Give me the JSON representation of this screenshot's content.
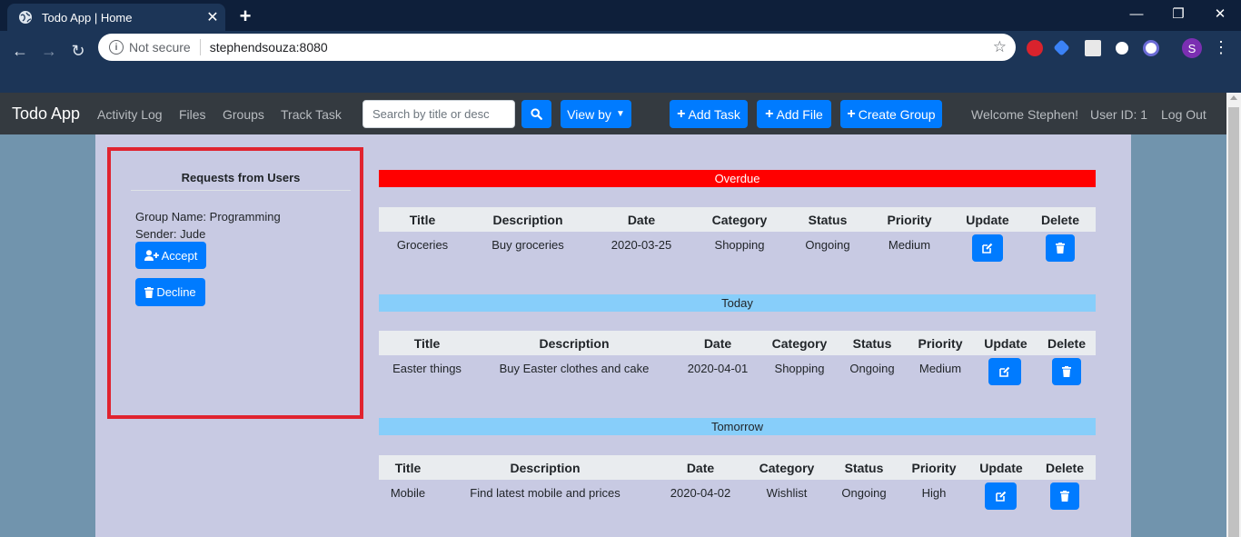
{
  "browser": {
    "tab_title": "Todo App | Home",
    "security_label": "Not secure",
    "url": "stephendsouza:8080",
    "profile_initial": "S"
  },
  "nav": {
    "brand": "Todo App",
    "links": [
      "Activity Log",
      "Files",
      "Groups",
      "Track Task"
    ],
    "search_placeholder": "Search by title or desc",
    "view_by": "View by",
    "add_task": "Add Task",
    "add_file": "Add File",
    "create_group": "Create Group",
    "welcome": "Welcome Stephen!",
    "user_id": "User ID: 1",
    "logout": "Log Out"
  },
  "requests": {
    "title": "Requests from Users",
    "group_name": "Group Name: Programming",
    "sender": "Sender: Jude",
    "accept": "Accept",
    "decline": "Decline"
  },
  "columns": [
    "Title",
    "Description",
    "Date",
    "Category",
    "Status",
    "Priority",
    "Update",
    "Delete"
  ],
  "sections": [
    {
      "label": "Overdue",
      "color": "#ff0000",
      "text_color": "#ffffff",
      "row": [
        "Groceries",
        "Buy groceries",
        "2020-03-25",
        "Shopping",
        "Ongoing",
        "Medium"
      ]
    },
    {
      "label": "Today",
      "color": "#87cefa",
      "text_color": "#212529",
      "row": [
        "Easter things",
        "Buy Easter clothes and cake",
        "2020-04-01",
        "Shopping",
        "Ongoing",
        "Medium"
      ]
    },
    {
      "label": "Tomorrow",
      "color": "#87cefa",
      "text_color": "#212529",
      "row": [
        "Mobile",
        "Find latest mobile and prices",
        "2020-04-02",
        "Wishlist",
        "Ongoing",
        "High"
      ]
    }
  ],
  "colors": {
    "primary": "#007bff",
    "navbar": "#343a40",
    "content_bg": "#c8cae3",
    "highlight_border": "#e0232f"
  }
}
